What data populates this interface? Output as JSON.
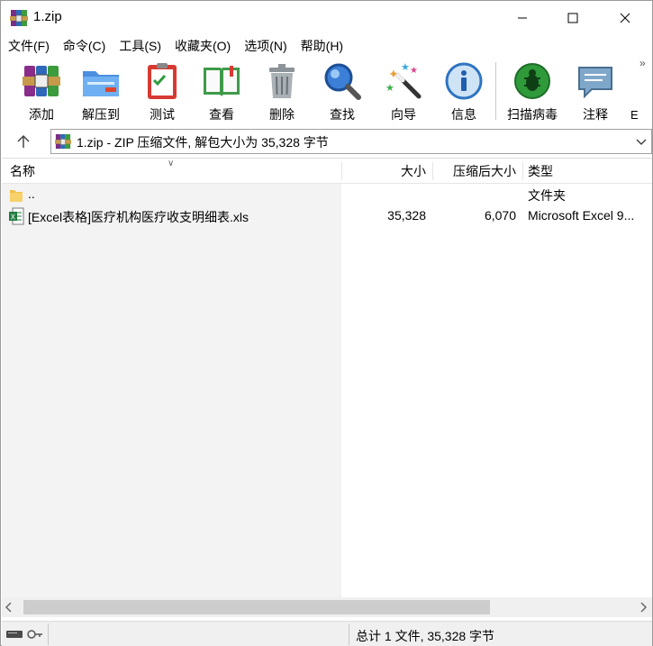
{
  "window": {
    "title": "1.zip"
  },
  "menu": [
    "文件(F)",
    "命令(C)",
    "工具(S)",
    "收藏夹(O)",
    "选项(N)",
    "帮助(H)"
  ],
  "toolbar": {
    "items": [
      {
        "label": "添加",
        "icon": "add-archive-icon"
      },
      {
        "label": "解压到",
        "icon": "extract-to-icon"
      },
      {
        "label": "测试",
        "icon": "test-icon"
      },
      {
        "label": "查看",
        "icon": "view-icon"
      },
      {
        "label": "删除",
        "icon": "delete-icon"
      },
      {
        "label": "查找",
        "icon": "find-icon"
      },
      {
        "label": "向导",
        "icon": "wizard-icon"
      },
      {
        "label": "信息",
        "icon": "info-icon"
      },
      {
        "label": "扫描病毒",
        "icon": "scan-virus-icon"
      },
      {
        "label": "注释",
        "icon": "comment-icon"
      }
    ],
    "more": "»",
    "cut_label": "E"
  },
  "address": {
    "text": "1.zip - ZIP 压缩文件, 解包大小为 35,328 字节"
  },
  "columns": {
    "name": "名称",
    "size": "大小",
    "packed": "压缩后大小",
    "type": "类型"
  },
  "files": [
    {
      "name": "..",
      "size": "",
      "packed": "",
      "type": "文件夹",
      "icon": "folder-icon"
    },
    {
      "name": "[Excel表格]医疗机构医疗收支明细表.xls",
      "size": "35,328",
      "packed": "6,070",
      "type": "Microsoft Excel 9...",
      "icon": "excel-file-icon"
    }
  ],
  "status": {
    "summary": "总计 1 文件, 35,328 字节"
  },
  "colors": {
    "folder": "#f2c14e",
    "excel": "#1d7a3e",
    "accent": "#0078d7"
  }
}
